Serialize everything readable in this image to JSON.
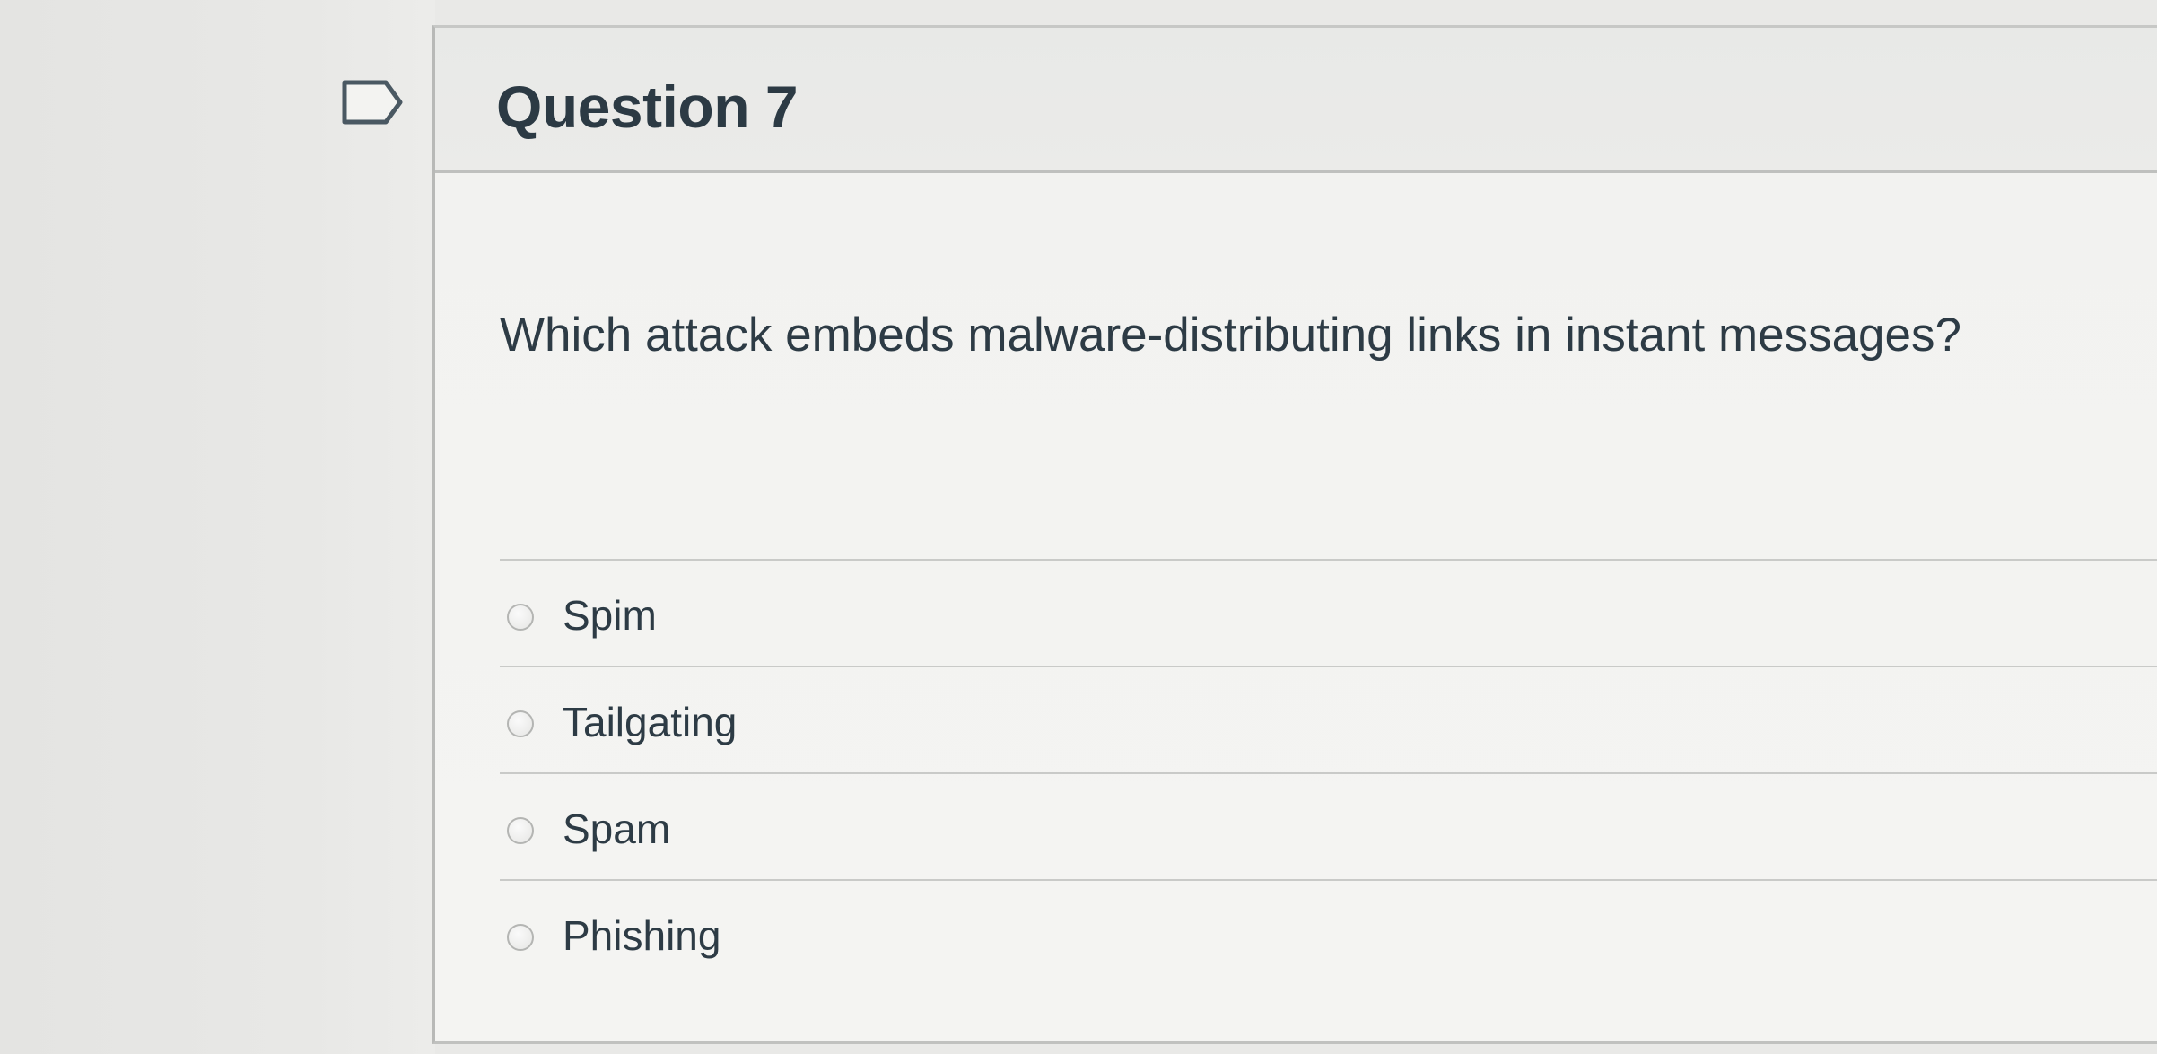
{
  "question": {
    "title": "Question 7",
    "text": "Which attack embeds malware-distributing links in instant messages?",
    "flag_icon": "flag-bookmark-icon",
    "answers": [
      {
        "label": "Spim"
      },
      {
        "label": "Tailgating"
      },
      {
        "label": "Spam"
      },
      {
        "label": "Phishing"
      }
    ]
  },
  "colors": {
    "text": "#2d3b45",
    "page_background": "#e9e9e7",
    "card_background": "#f2f2f0",
    "divider": "#c9cac8"
  }
}
